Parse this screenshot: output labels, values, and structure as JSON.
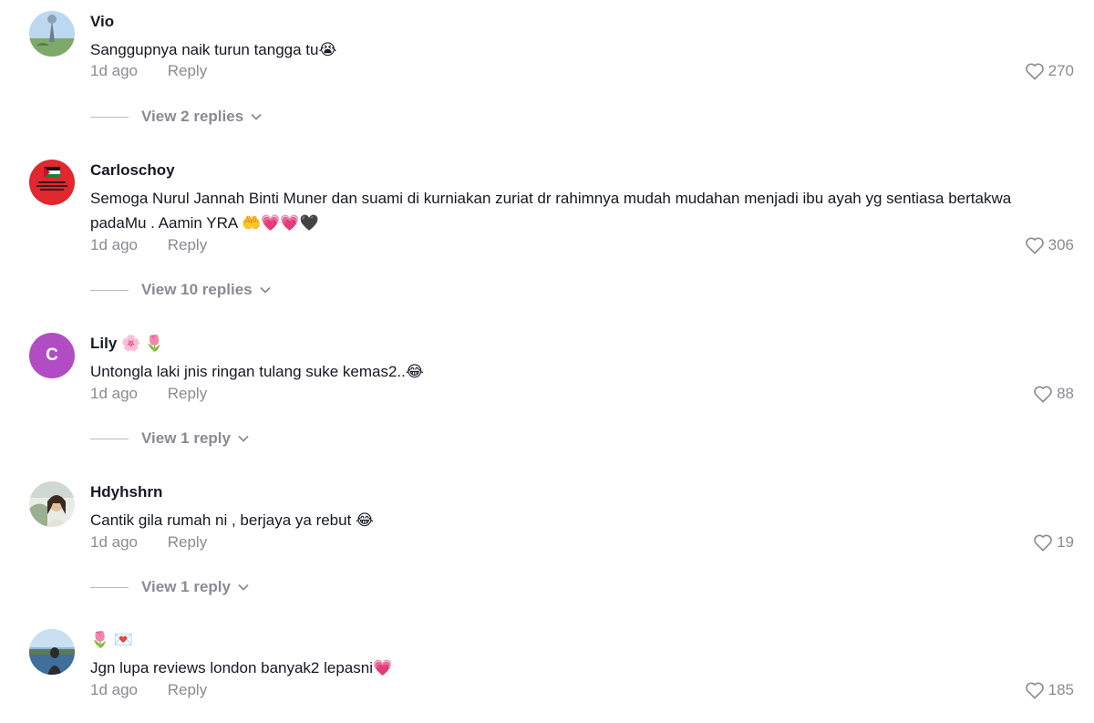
{
  "comments": [
    {
      "username": "Vio",
      "username_emoji": "",
      "text": "Sanggupnya naik turun tangga tu😭",
      "time": "1d ago",
      "reply_label": "Reply",
      "likes": "270",
      "view_replies": "View 2 replies",
      "avatar": "photo-avatar"
    },
    {
      "username": "Carloschoy",
      "username_emoji": "",
      "text": "Semoga Nurul Jannah Binti Muner dan suami di kurniakan zuriat dr rahimnya mudah mudahan menjadi ibu ayah yg sentiasa bertakwa padaMu . Aamin YRA 🤲💗💗🖤",
      "time": "1d ago",
      "reply_label": "Reply",
      "likes": "306",
      "view_replies": "View 10 replies",
      "avatar": "flag-avatar"
    },
    {
      "username": "Lily",
      "username_emoji": "🌸 🌷",
      "text": "Untongla laki jnis ringan tulang suke kemas2..😂",
      "time": "1d ago",
      "reply_label": "Reply",
      "likes": "88",
      "view_replies": "View 1 reply",
      "avatar": "letter-avatar",
      "avatar_letter": "C"
    },
    {
      "username": "Hdyhshrn",
      "username_emoji": "",
      "text": "Cantik gila rumah ni , berjaya ya rebut 😂",
      "time": "1d ago",
      "reply_label": "Reply",
      "likes": "19",
      "view_replies": "View 1 reply",
      "avatar": "photo-avatar"
    },
    {
      "username": "",
      "username_emoji": "🌷 💌",
      "text": "Jgn lupa reviews london banyak2 lepasni💗",
      "time": "1d ago",
      "reply_label": "Reply",
      "likes": "185",
      "avatar": "photo-avatar"
    }
  ],
  "icons": {
    "like": "heart-outline-icon",
    "expand": "chevron-down-icon"
  },
  "colors": {
    "text": "#161823",
    "muted": "#8a8b91",
    "letter_avatar_bg": "#b24cc5",
    "flag_avatar_bg": "#e0282e"
  }
}
